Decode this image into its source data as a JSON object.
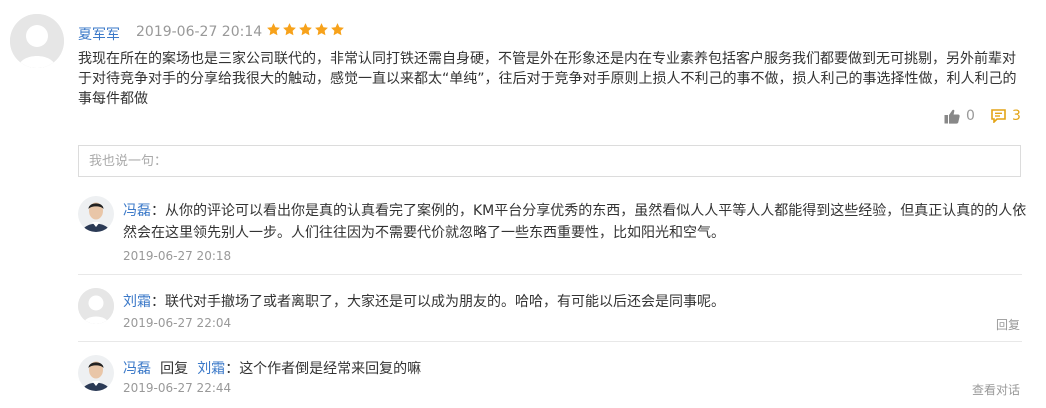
{
  "main_comment": {
    "author": "夏军军",
    "time": "2019-06-27 20:14",
    "rating": 5,
    "text": "我现在所在的案场也是三家公司联代的，非常认同打铁还需自身硬，不管是外在形象还是内在专业素养包括客户服务我们都要做到无可挑剔，另外前辈对于对待竞争对手的分享给我很大的触动，感觉一直以来都太“单纯”，往后对于竞争对手原则上损人不利己的事不做，损人利己的事选择性做，利人利己的事每件都做",
    "like_count": "0",
    "reply_count": "3"
  },
  "reply_input": {
    "placeholder": "我也说一句："
  },
  "replies": [
    {
      "author": "冯磊",
      "separator": "：",
      "text": "从你的评论可以看出你是真的认真看完了案例的，KM平台分享优秀的东西，虽然看似人人平等人人都能得到这些经验，但真正认真的的人依然会在这里领先别人一步。人们往往因为不需要代价就忽略了一些东西重要性，比如阳光和空气。",
      "time": "2019-06-27 20:18"
    },
    {
      "author": "刘霜",
      "separator": "：",
      "text": "联代对手撤场了或者离职了，大家还是可以成为朋友的。哈哈，有可能以后还会是同事呢。",
      "time": "2019-06-27 22:04",
      "action": "回复"
    },
    {
      "author": "冯磊",
      "reply_word": "回复",
      "target": "刘霜",
      "separator": "：",
      "text": "这个作者倒是经常来回复的嘛",
      "time": "2019-06-27 22:44",
      "action": "查看对话"
    }
  ],
  "colors": {
    "link": "#3a78c8",
    "star": "#f7a21b",
    "reply_icon": "#e3a416",
    "muted": "#999999"
  }
}
